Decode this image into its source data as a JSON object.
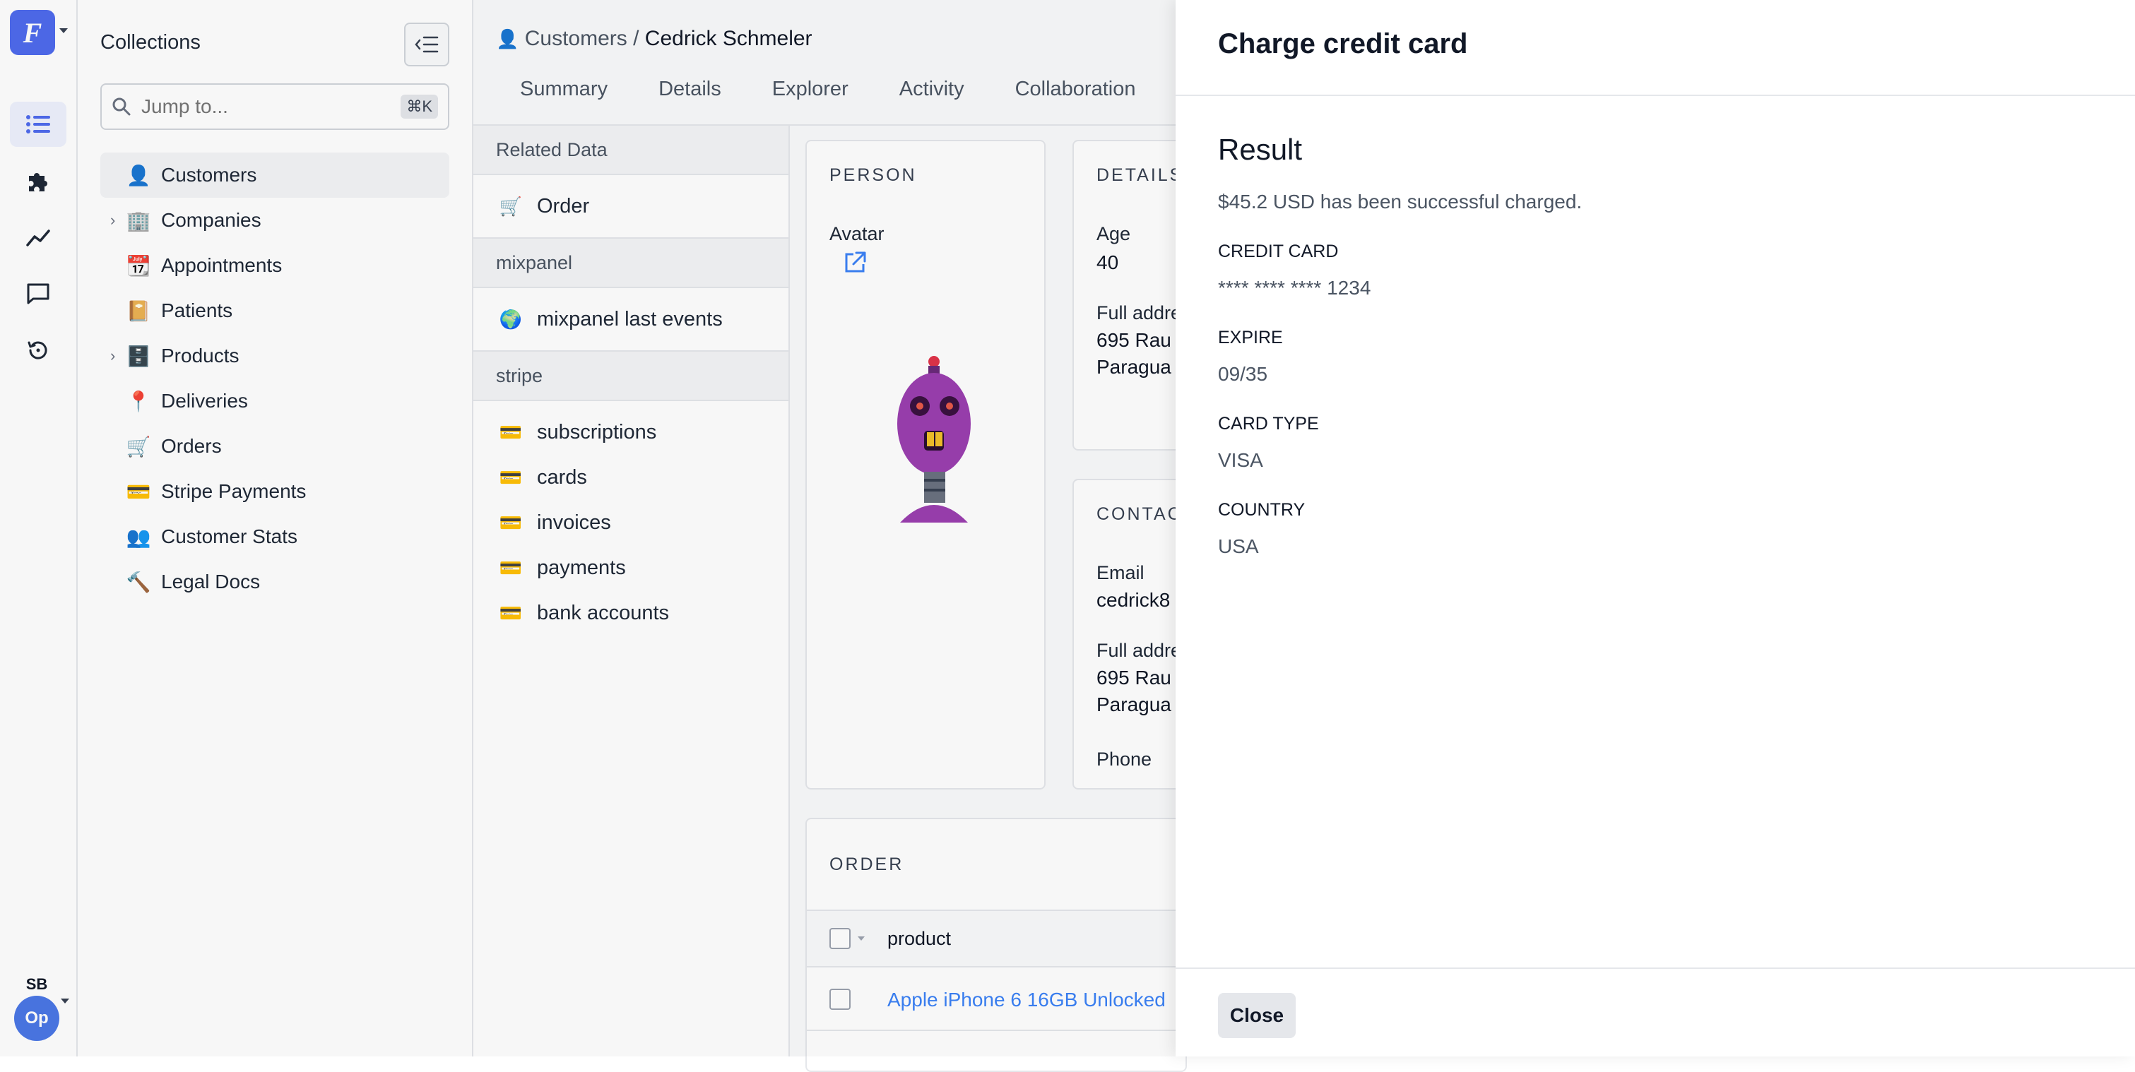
{
  "app": {
    "logo_letter": "F"
  },
  "rail": {
    "items": [
      {
        "icon": "list-icon"
      },
      {
        "icon": "puzzle-icon"
      },
      {
        "icon": "chart-line-icon"
      },
      {
        "icon": "chat-icon"
      },
      {
        "icon": "history-icon"
      }
    ],
    "avatar_initials": "SB",
    "project_initials": "Op"
  },
  "collections": {
    "title": "Collections",
    "search_placeholder": "Jump to...",
    "shortcut": "⌘K",
    "items": [
      {
        "emoji": "👤",
        "label": "Customers",
        "selected": true,
        "expandable": false
      },
      {
        "emoji": "🏢",
        "label": "Companies",
        "selected": false,
        "expandable": true
      },
      {
        "emoji": "📆",
        "label": "Appointments",
        "selected": false,
        "expandable": false
      },
      {
        "emoji": "📔",
        "label": "Patients",
        "selected": false,
        "expandable": false
      },
      {
        "emoji": "🗄️",
        "label": "Products",
        "selected": false,
        "expandable": true
      },
      {
        "emoji": "📍",
        "label": "Deliveries",
        "selected": false,
        "expandable": false
      },
      {
        "emoji": "🛒",
        "label": "Orders",
        "selected": false,
        "expandable": false
      },
      {
        "emoji": "💳",
        "label": "Stripe Payments",
        "selected": false,
        "expandable": false
      },
      {
        "emoji": "👥",
        "label": "Customer Stats",
        "selected": false,
        "expandable": false
      },
      {
        "emoji": "🔨",
        "label": "Legal Docs",
        "selected": false,
        "expandable": false
      }
    ]
  },
  "record": {
    "breadcrumb": {
      "icon": "👤",
      "parent": "Customers",
      "separator": "/",
      "current": "Cedrick Schmeler"
    },
    "tabs": [
      "Summary",
      "Details",
      "Explorer",
      "Activity",
      "Collaboration"
    ],
    "related": {
      "header": "Related Data",
      "items": [
        {
          "emoji": "🛒",
          "label": "Order"
        }
      ],
      "groups": [
        {
          "name": "mixpanel",
          "items": [
            {
              "emoji": "🌍",
              "label": "mixpanel last events"
            }
          ]
        },
        {
          "name": "stripe",
          "items": [
            {
              "emoji": "💳",
              "label": "subscriptions"
            },
            {
              "emoji": "💳",
              "label": "cards"
            },
            {
              "emoji": "💳",
              "label": "invoices"
            },
            {
              "emoji": "💳",
              "label": "payments"
            },
            {
              "emoji": "💳",
              "label": "bank accounts"
            }
          ]
        }
      ]
    },
    "person": {
      "title": "PERSON",
      "avatar_label": "Avatar"
    },
    "details": {
      "title": "DETAILS",
      "age_label": "Age",
      "age": "40",
      "address_label": "Full addre",
      "address_line1": "695 Rau",
      "address_line2": "Paragua"
    },
    "contact": {
      "title": "CONTAC",
      "email_label": "Email",
      "email": "cedrick8",
      "address_label": "Full addre",
      "address_line1": "695 Rau",
      "address_line2": "Paragua",
      "phone_label": "Phone"
    },
    "order": {
      "title": "ORDER",
      "column": "product",
      "row_product": "Apple iPhone 6 16GB Unlocked"
    }
  },
  "drawer": {
    "title": "Charge credit card",
    "result_title": "Result",
    "message": "$45.2 USD has been successful charged.",
    "fields": [
      {
        "label": "CREDIT CARD",
        "value": "**** **** **** 1234"
      },
      {
        "label": "EXPIRE",
        "value": "09/35"
      },
      {
        "label": "CARD TYPE",
        "value": "VISA"
      },
      {
        "label": "COUNTRY",
        "value": "USA"
      }
    ],
    "close_label": "Close"
  },
  "colors": {
    "accent": "#4f6bed",
    "link": "#3b82f6",
    "avatar_bg": "#4b77e6"
  }
}
